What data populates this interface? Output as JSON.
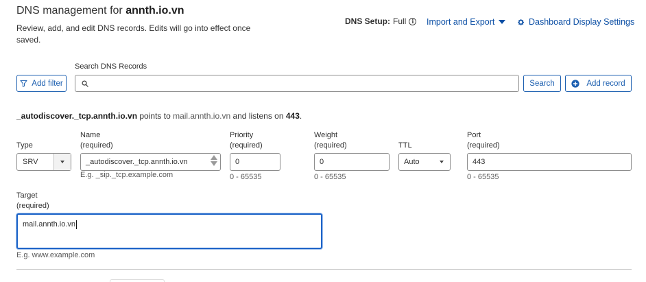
{
  "header": {
    "title_prefix": "DNS management for ",
    "domain": "annth.io.vn",
    "subtitle": "Review, add, and edit DNS records. Edits will go into effect once saved.",
    "dns_setup_label": "DNS Setup:",
    "dns_setup_value": "Full",
    "import_export_label": "Import and Export",
    "dashboard_settings_label": "Dashboard Display Settings"
  },
  "toolbar": {
    "add_filter_label": "Add filter",
    "search_label": "Search DNS Records",
    "search_value": "",
    "search_button_label": "Search",
    "add_record_label": "Add record"
  },
  "record_summary": {
    "name": "_autodiscover._tcp.annth.io.vn",
    "points_to_text": " points to ",
    "target": "mail.annth.io.vn",
    "listens_on_text": " and listens on ",
    "port": "443",
    "end": "."
  },
  "form": {
    "type": {
      "label": "Type",
      "value": "SRV"
    },
    "name": {
      "label": "Name",
      "required": "(required)",
      "value": "_autodiscover._tcp.annth.io.vn",
      "hint": "E.g. _sip._tcp.example.com"
    },
    "priority": {
      "label": "Priority",
      "required": "(required)",
      "value": "0",
      "hint": "0 - 65535"
    },
    "weight": {
      "label": "Weight",
      "required": "(required)",
      "value": "0",
      "hint": "0 - 65535"
    },
    "ttl": {
      "label": "TTL",
      "value": "Auto"
    },
    "port": {
      "label": "Port",
      "required": "(required)",
      "value": "443",
      "hint": "0 - 65535"
    },
    "target": {
      "label": "Target",
      "required": "(required)",
      "value": "mail.annth.io.vn",
      "hint": "E.g. www.example.com"
    }
  },
  "colors": {
    "link": "#0c4fa5",
    "button_border": "#1c5fb0",
    "focus_border": "#1e64c8",
    "text": "#313131"
  },
  "icons": {
    "info": "info-circle-icon",
    "caret": "caret-down-icon",
    "gear": "gear-icon",
    "filter": "filter-icon",
    "search": "search-icon",
    "plus": "plus-circle-icon"
  }
}
